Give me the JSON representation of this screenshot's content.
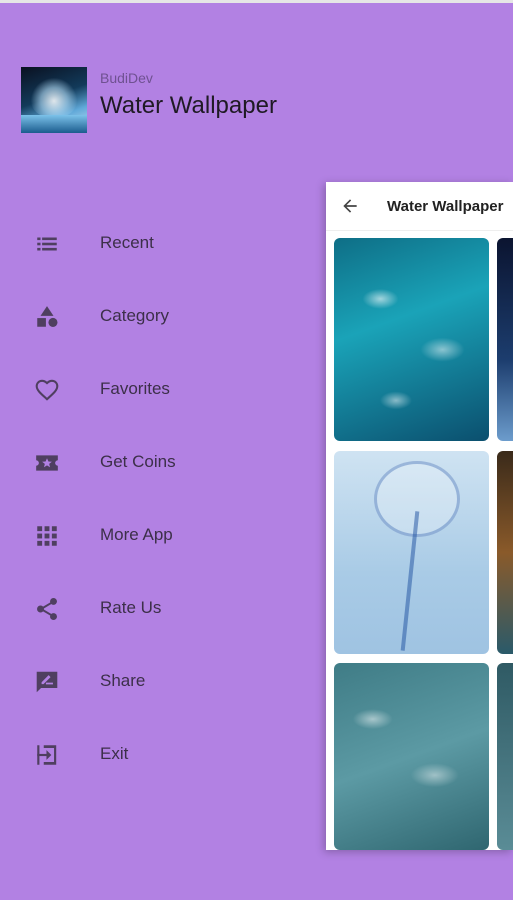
{
  "drawer": {
    "developer": "BudiDev",
    "app_title": "Water Wallpaper",
    "menu": [
      {
        "label": "Recent",
        "icon": "list-icon"
      },
      {
        "label": "Category",
        "icon": "shapes-icon"
      },
      {
        "label": "Favorites",
        "icon": "heart-icon"
      },
      {
        "label": "Get Coins",
        "icon": "ticket-star-icon"
      },
      {
        "label": "More App",
        "icon": "grid-icon"
      },
      {
        "label": "Rate Us",
        "icon": "share-icon"
      },
      {
        "label": "Share",
        "icon": "feedback-icon"
      },
      {
        "label": "Exit",
        "icon": "exit-icon"
      }
    ]
  },
  "preview": {
    "title": "Water Wallpaper"
  },
  "colors": {
    "drawer_background": "#b281e3",
    "icon_color": "#4f3f60",
    "text_color": "#3c2f49"
  }
}
